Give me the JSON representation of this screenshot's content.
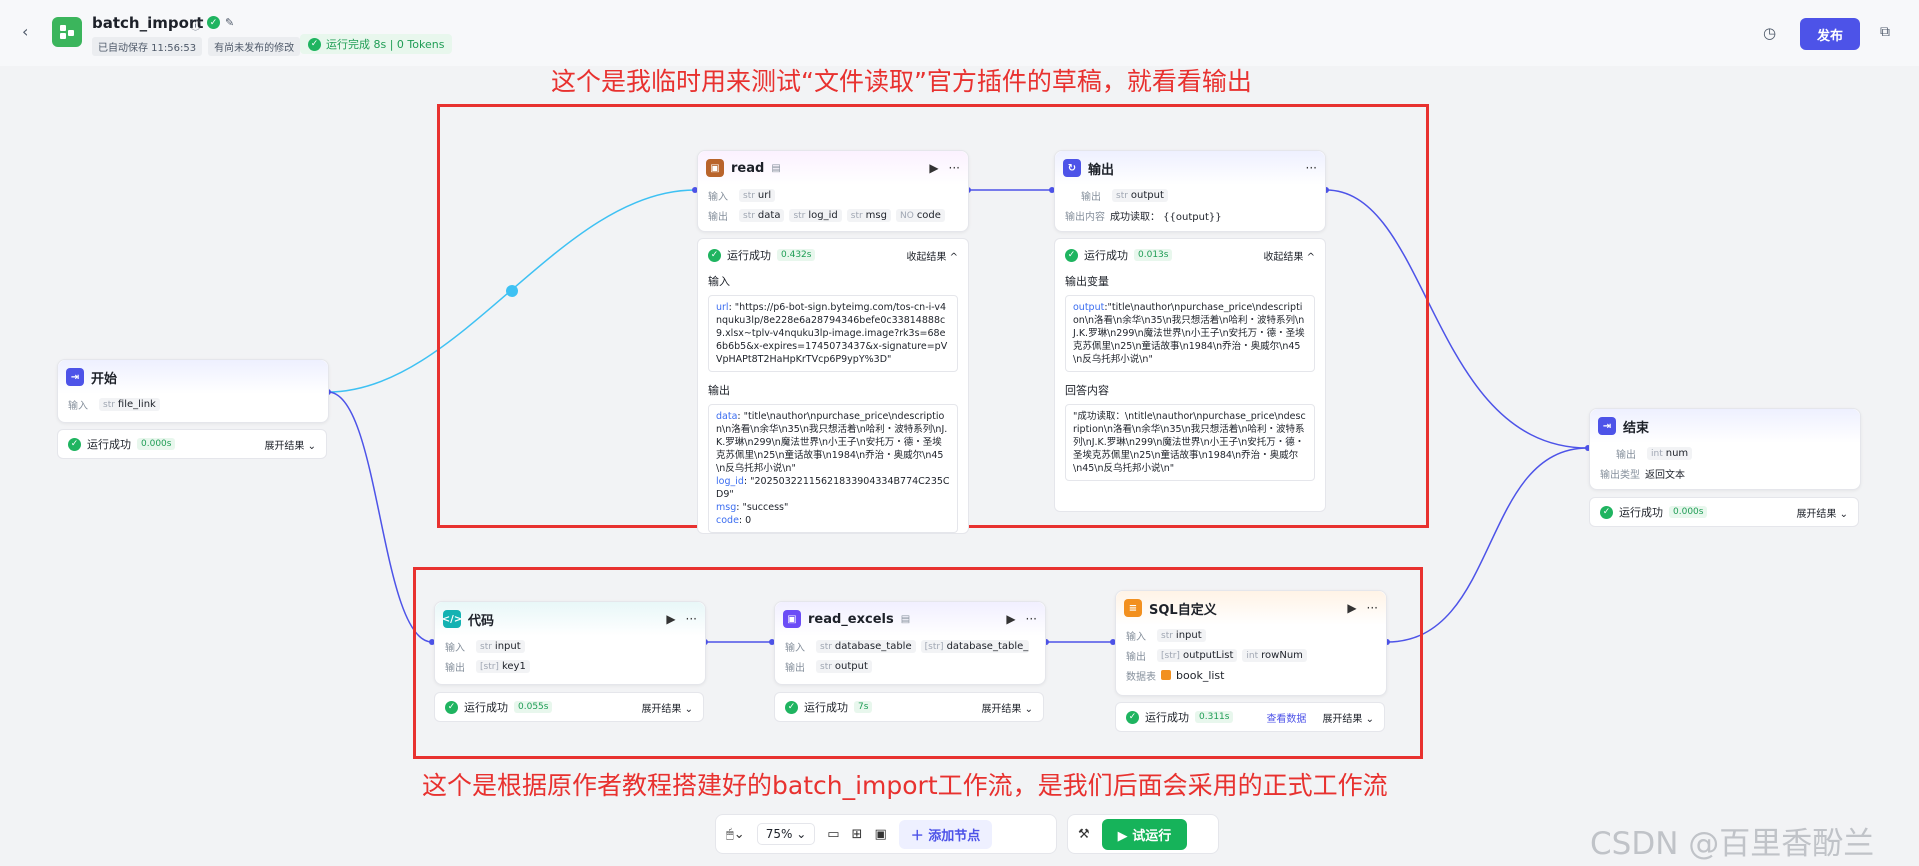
{
  "header": {
    "title": "batch_import",
    "autosave": "已自动保存 11:56:53",
    "unpublished": "有尚未发布的修改",
    "run_status": "运行完成 8s | 0 Tokens",
    "publish_label": "发布"
  },
  "annotations": {
    "top": "这个是我临时用来测试“文件读取”官方插件的草稿，就看看输出",
    "bottom": "这个是根据原作者教程搭建好的batch_import工作流，是我们后面会采用的正式工作流"
  },
  "common": {
    "input": "输入",
    "output": "输出",
    "success": "运行成功",
    "expand": "展开结果 ⌄",
    "collapse": "收起结果 ^",
    "str": "str",
    "int": "int",
    "num_type": "NO",
    "arr": "[str]",
    "view_data": "查看数据"
  },
  "nodes": {
    "start": {
      "title": "开始",
      "input_field": "file_link",
      "duration": "0.000s"
    },
    "read": {
      "title": "read",
      "input_field": "url",
      "outputs": [
        "data",
        "log_id",
        "msg",
        "code"
      ],
      "duration": "0.432s",
      "input_section": "输入",
      "input_text_key": "url",
      "input_text_val": ": \"https://p6-bot-sign.byteimg.com/tos-cn-i-v4nquku3lp/8e228e6a28794346befe0c33814888c9.xlsx~tplv-v4nquku3lp-image.image?rk3s=68e6b6b5&x-expires=1745073437&x-signature=pVVpHAPt8T2HaHpKrTVcp6P9ypY%3D\"",
      "output_section": "输出",
      "out_data_key": "data",
      "out_data_val": ": \"title\\nauthor\\npurchase_price\\ndescription\\n洛看\\n余华\\n35\\n我只想活着\\n哈利・波特系列\\nJ.K.罗琳\\n299\\n魔法世界\\n小王子\\n安托万・德・圣埃克苏佩里\\n25\\n童话故事\\n1984\\n乔治・奥威尔\\n45\\n反乌托邦小说\\n\"",
      "out_log_key": "log_id",
      "out_log_val": ": \"20250322115621833904334B774C235CD9\"",
      "out_msg_key": "msg",
      "out_msg_val": ": \"success\"",
      "out_code_key": "code",
      "out_code_val": ": 0"
    },
    "output_node": {
      "title": "输出",
      "output_field": "output",
      "content_label": "输出内容",
      "content_value": "成功读取：  {{output}}",
      "duration": "0.013s",
      "var_section": "输出变量",
      "var_key": "output",
      "var_val": ":\"title\\nauthor\\npurchase_price\\ndescription\\n洛看\\n余华\\n35\\n我只想活着\\n哈利・波特系列\\nJ.K.罗琳\\n299\\n魔法世界\\n小王子\\n安托万・德・圣埃克苏佩里\\n25\\n童话故事\\n1984\\n乔治・奥威尔\\n45\\n反乌托邦小说\\n\"",
      "answer_section": "回答内容",
      "answer_val": "\"成功读取：\\ntitle\\nauthor\\npurchase_price\\ndescription\\n洛看\\n余华\\n35\\n我只想活着\\n哈利・波特系列\\nJ.K.罗琳\\n299\\n魔法世界\\n小王子\\n安托万・德・圣埃克苏佩里\\n25\\n童话故事\\n1984\\n乔治・奥威尔\\n45\\n反乌托邦小说\\n\""
    },
    "end": {
      "title": "结束",
      "output_field": "num",
      "type_label": "输出类型",
      "type_value": "返回文本",
      "duration": "0.000s"
    },
    "code": {
      "title": "代码",
      "input_field": "input",
      "output_field": "key1",
      "duration": "0.055s"
    },
    "read_excels": {
      "title": "read_excels",
      "input_field_1": "database_table",
      "input_field_2": "database_table_list",
      "output_field": "output",
      "duration": "7s"
    },
    "sql": {
      "title": "SQL自定义",
      "input_field": "input",
      "output_field_1": "outputList",
      "output_field_2": "rowNum",
      "db_label": "数据表",
      "db_value": "book_list",
      "duration": "0.311s"
    }
  },
  "toolbar": {
    "zoom": "75%",
    "add_node": "添加节点",
    "test_run": "试运行"
  },
  "watermark": "CSDN @百里香酚兰"
}
